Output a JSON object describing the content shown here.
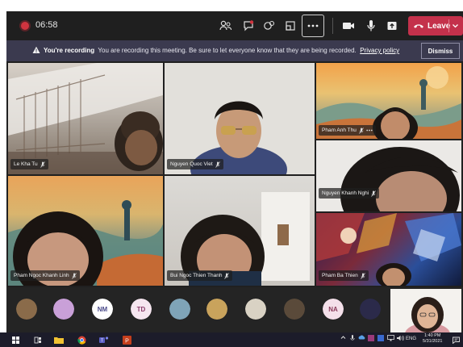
{
  "meeting": {
    "elapsed_time": "06:58",
    "leave_label": "Leave",
    "recording_banner": {
      "title": "You're recording",
      "message": "You are recording this meeting. Be sure to let everyone know that they are being recorded.",
      "link": "Privacy policy",
      "dismiss_label": "Dismiss"
    },
    "toolbar_icons": [
      "people-icon",
      "chat-icon",
      "reactions-icon",
      "share-tray-icon",
      "more-options-icon",
      "camera-icon",
      "microphone-icon",
      "share-icon",
      "phone-hangup-icon"
    ]
  },
  "participants": [
    {
      "name": "Le Kha Tu",
      "muted": true
    },
    {
      "name": "Nguyen Quoc Viet",
      "muted": true
    },
    {
      "name": "Pham Anh Thu",
      "muted": true
    },
    {
      "name": "Nguyen Khanh Nghi",
      "muted": true
    },
    {
      "name": "Pham Ngoc Khanh Linh",
      "muted": true
    },
    {
      "name": "Bui Ngoc Thien Thanh",
      "muted": true
    },
    {
      "name": "Pham Ba Thien",
      "muted": true
    }
  ],
  "avatar_strip": [
    {
      "initials": "",
      "color": "#8a6b4a"
    },
    {
      "initials": "",
      "color": "#c9a0d8"
    },
    {
      "initials": "NM",
      "color": "#ffffff"
    },
    {
      "initials": "TD",
      "color": "#f6e6f0"
    },
    {
      "initials": "",
      "color": "#7fa4b8"
    },
    {
      "initials": "",
      "color": "#c9a35c"
    },
    {
      "initials": "",
      "color": "#d9d2c4"
    },
    {
      "initials": "",
      "color": "#5a4a3a"
    },
    {
      "initials": "NA",
      "color": "#f4e0ea"
    },
    {
      "initials": "",
      "color": "#2b2a4a"
    }
  ],
  "taskbar": {
    "language": "ENG",
    "time": "1:40 PM",
    "date": "5/31/2021"
  },
  "colors": {
    "leave": "#c4314b",
    "banner": "#3b3a4f",
    "toolbar": "#1f1f1f"
  }
}
